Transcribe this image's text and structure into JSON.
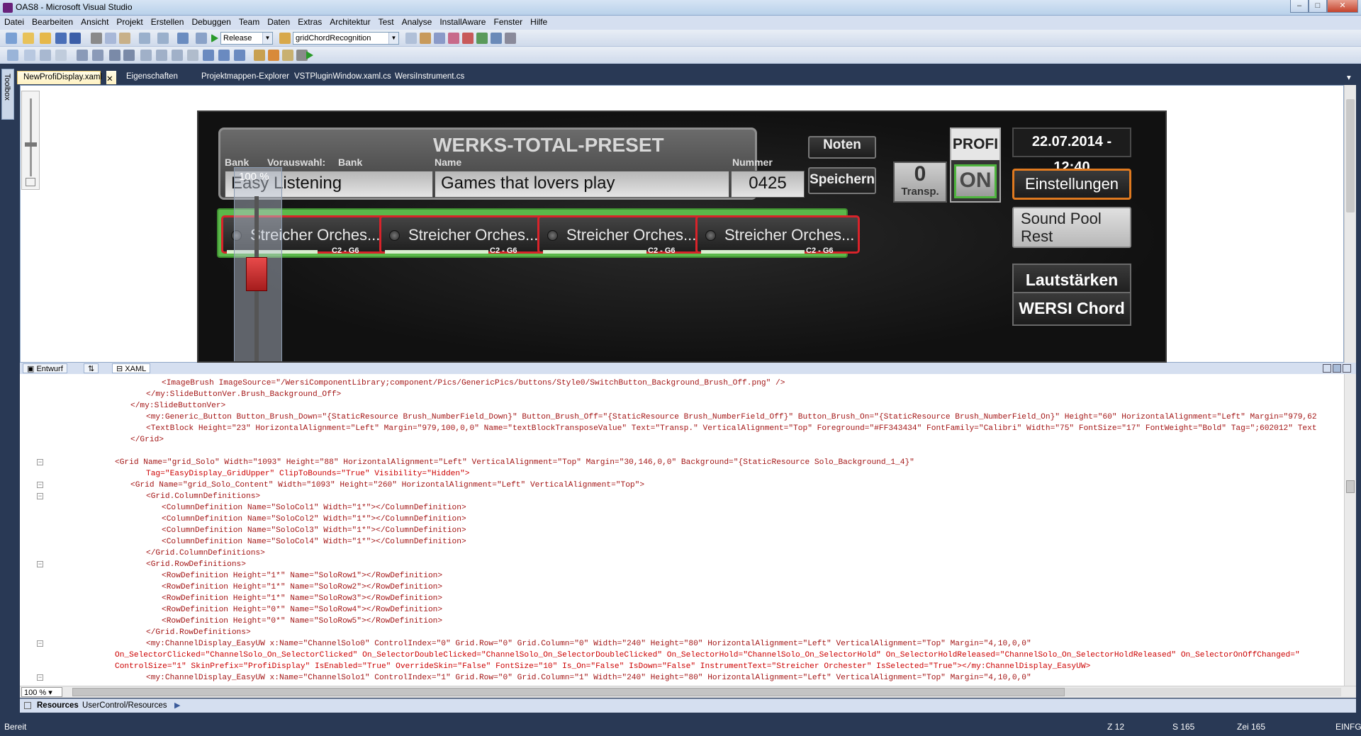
{
  "window": {
    "title": "OAS8 - Microsoft Visual Studio",
    "min_label": "‒",
    "max_label": "□",
    "close_label": "✕"
  },
  "menu": [
    "Datei",
    "Bearbeiten",
    "Ansicht",
    "Projekt",
    "Erstellen",
    "Debuggen",
    "Team",
    "Daten",
    "Extras",
    "Architektur",
    "Test",
    "Analyse",
    "InstallAware",
    "Fenster",
    "Hilfe"
  ],
  "toolbar": {
    "config": "Release",
    "search": "gridChordRecognition"
  },
  "toolbox_label": "Toolbox",
  "tabs": [
    "NewProfiDisplay.xaml",
    "Eigenschaften",
    "Projektmappen-Explorer",
    "VSTPluginWindow.xaml.cs",
    "WersiInstrument.cs"
  ],
  "tab_close": "✕",
  "designer": {
    "zoom_overlay": "100 %",
    "title": "WERKS-TOTAL-PRESET",
    "bank_label": "Bank",
    "vorauswahl_label": "Vorauswahl:",
    "vorauswahl_bank": "Bank",
    "name_label": "Name",
    "nummer_label": "Nummer",
    "bank_value": "Easy Listening",
    "name_value": "Games that lovers play",
    "nummer_value": "0425",
    "noten": "Noten",
    "speichern": "Speichern",
    "transp_value": "0",
    "transp_label": "Transp.",
    "profi": "PROFI",
    "on": "ON",
    "datetime": "22.07.2014 - 12:40",
    "einstellungen": "Einstellungen",
    "soundpool": "Sound Pool Rest",
    "lautstaerken": "Lautstärken",
    "wersi_chord": "WERSI Chord",
    "solos": [
      {
        "name": "Streicher Orches...",
        "range": "C2 - G6"
      },
      {
        "name": "Streicher Orches...",
        "range": "C2 - G6"
      },
      {
        "name": "Streicher Orches...",
        "range": "C2 - G6"
      },
      {
        "name": "Streicher Orches...",
        "range": "C2 - G6"
      }
    ],
    "colors": {
      "solo_bg": "#5bb84a",
      "solo_border": "#d8232a",
      "accent_orange": "#e07a20"
    }
  },
  "split": {
    "design": "Entwurf",
    "swap": "⇅",
    "xaml": "XAML"
  },
  "code": [
    {
      "t": "<ImageBrush ImageSource=\"/WersiComponentLibrary;component/Pics/GenericPics/buttons/Style0/SwitchButton_Background_Brush_Off.png\" />"
    },
    {
      "t": "</my:SlideButtonVer.Brush_Background_Off>"
    },
    {
      "t": "</my:SlideButtonVer>"
    },
    {
      "t": "<my:Generic_Button Button_Brush_Down=\"{StaticResource Brush_NumberField_Down}\" Button_Brush_Off=\"{StaticResource Brush_NumberField_Off}\" Button_Brush_On=\"{StaticResource Brush_NumberField_On}\" Height=\"60\" HorizontalAlignment=\"Left\" Margin=\"979,62"
    },
    {
      "t": "<TextBlock Height=\"23\" HorizontalAlignment=\"Left\" Margin=\"979,100,0,0\" Name=\"textBlockTransposeValue\" Text=\"Transp.\" VerticalAlignment=\"Top\" Foreground=\"#FF343434\" FontFamily=\"Calibri\" Width=\"75\" FontSize=\"17\" FontWeight=\"Bold\" Tag=\";602012\" Text"
    },
    {
      "t": "</Grid>"
    },
    {
      "t": ""
    },
    {
      "t": "<Grid Name=\"grid_Solo\" Width=\"1093\" Height=\"88\" HorizontalAlignment=\"Left\" VerticalAlignment=\"Top\" Margin=\"30,146,0,0\" Background=\"{StaticResource Solo_Background_1_4}\""
    },
    {
      "t": "Tag=\"EasyDisplay_GridUpper\" ClipToBounds=\"True\" Visibility=\"Hidden\">"
    },
    {
      "t": "<Grid Name=\"grid_Solo_Content\" Width=\"1093\" Height=\"260\" HorizontalAlignment=\"Left\" VerticalAlignment=\"Top\">"
    },
    {
      "t": "<Grid.ColumnDefinitions>"
    },
    {
      "t": "<ColumnDefinition Name=\"SoloCol1\" Width=\"1*\"></ColumnDefinition>"
    },
    {
      "t": "<ColumnDefinition Name=\"SoloCol2\" Width=\"1*\"></ColumnDefinition>"
    },
    {
      "t": "<ColumnDefinition Name=\"SoloCol3\" Width=\"1*\"></ColumnDefinition>"
    },
    {
      "t": "<ColumnDefinition Name=\"SoloCol4\" Width=\"1*\"></ColumnDefinition>"
    },
    {
      "t": "</Grid.ColumnDefinitions>"
    },
    {
      "t": "<Grid.RowDefinitions>"
    },
    {
      "t": "<RowDefinition Height=\"1*\" Name=\"SoloRow1\"></RowDefinition>"
    },
    {
      "t": "<RowDefinition Height=\"1*\" Name=\"SoloRow2\"></RowDefinition>"
    },
    {
      "t": "<RowDefinition Height=\"1*\" Name=\"SoloRow3\"></RowDefinition>"
    },
    {
      "t": "<RowDefinition Height=\"0*\" Name=\"SoloRow4\"></RowDefinition>"
    },
    {
      "t": "<RowDefinition Height=\"0*\" Name=\"SoloRow5\"></RowDefinition>"
    },
    {
      "t": "</Grid.RowDefinitions>"
    },
    {
      "t": "<my:ChannelDisplay_EasyUW x:Name=\"ChannelSolo0\" ControlIndex=\"0\" Grid.Row=\"0\" Grid.Column=\"0\" Width=\"240\" Height=\"80\" HorizontalAlignment=\"Left\" VerticalAlignment=\"Top\" Margin=\"4,10,0,0\""
    },
    {
      "t": "On_SelectorClicked=\"ChannelSolo_On_SelectorClicked\" On_SelectorDoubleClicked=\"ChannelSolo_On_SelectorDoubleClicked\" On_SelectorHold=\"ChannelSolo_On_SelectorHold\" On_SelectorHoldReleased=\"ChannelSolo_On_SelectorHoldReleased\" On_SelectorOnOffChanged=\""
    },
    {
      "t": "ControlSize=\"1\" SkinPrefix=\"ProfiDisplay\" IsEnabled=\"True\" OverrideSkin=\"False\" FontSize=\"10\" Is_On=\"False\" IsDown=\"False\" InstrumentText=\"Streicher Orchester\" IsSelected=\"True\"></my:ChannelDisplay_EasyUW>"
    },
    {
      "t": "<my:ChannelDisplay_EasyUW x:Name=\"ChannelSolo1\" ControlIndex=\"1\" Grid.Row=\"0\" Grid.Column=\"1\" Width=\"240\" Height=\"80\" HorizontalAlignment=\"Left\" VerticalAlignment=\"Top\" Margin=\"4,10,0,0\""
    }
  ],
  "editor_zoom": "100 %",
  "pathbar": {
    "resources": "Resources",
    "path": "UserControl/Resources"
  },
  "status": {
    "ready": "Bereit",
    "line": "Z 12",
    "col": "S 165",
    "char": "Zei 165",
    "mode": "EINFG"
  }
}
